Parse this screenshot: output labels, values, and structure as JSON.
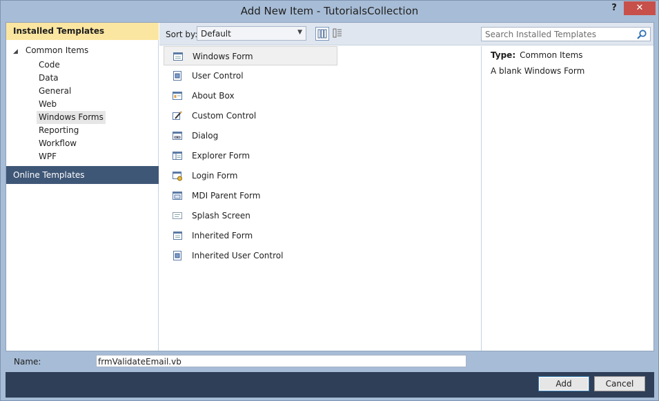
{
  "window": {
    "title": "Add New Item - TutorialsCollection",
    "help_label": "?",
    "close_label": "✕"
  },
  "left_pane": {
    "installed_header": "Installed Templates",
    "tree_root": "Common Items",
    "tree_items": [
      "Code",
      "Data",
      "General",
      "Web",
      "Windows Forms",
      "Reporting",
      "Workflow",
      "WPF"
    ],
    "selected_item": "Windows Forms",
    "online_header": "Online Templates"
  },
  "toolbar": {
    "sort_label": "Sort by:",
    "sort_value": "Default",
    "search_placeholder": "Search Installed Templates"
  },
  "items": [
    {
      "label": "Windows Form",
      "icon": "windows-form-icon"
    },
    {
      "label": "User Control",
      "icon": "user-control-icon"
    },
    {
      "label": "About Box",
      "icon": "about-box-icon"
    },
    {
      "label": "Custom Control",
      "icon": "custom-control-icon"
    },
    {
      "label": "Dialog",
      "icon": "dialog-icon"
    },
    {
      "label": "Explorer Form",
      "icon": "explorer-form-icon"
    },
    {
      "label": "Login Form",
      "icon": "login-form-icon"
    },
    {
      "label": "MDI Parent Form",
      "icon": "mdi-parent-form-icon"
    },
    {
      "label": "Splash Screen",
      "icon": "splash-screen-icon"
    },
    {
      "label": "Inherited Form",
      "icon": "inherited-form-icon"
    },
    {
      "label": "Inherited User Control",
      "icon": "inherited-user-control-icon"
    }
  ],
  "selected_template": "Windows Form",
  "details": {
    "type_label": "Type:",
    "type_value": "Common Items",
    "description": "A blank Windows Form"
  },
  "name_row": {
    "label": "Name:",
    "value": "frmValidateEmail.vb"
  },
  "buttons": {
    "add": "Add",
    "cancel": "Cancel"
  },
  "colors": {
    "window_frame": "#a7bcd6",
    "installed_header_bg": "#fbe6a1",
    "online_header_bg": "#3f5777",
    "button_bar_bg": "#2f3f58",
    "close_button_bg": "#c7504a"
  }
}
